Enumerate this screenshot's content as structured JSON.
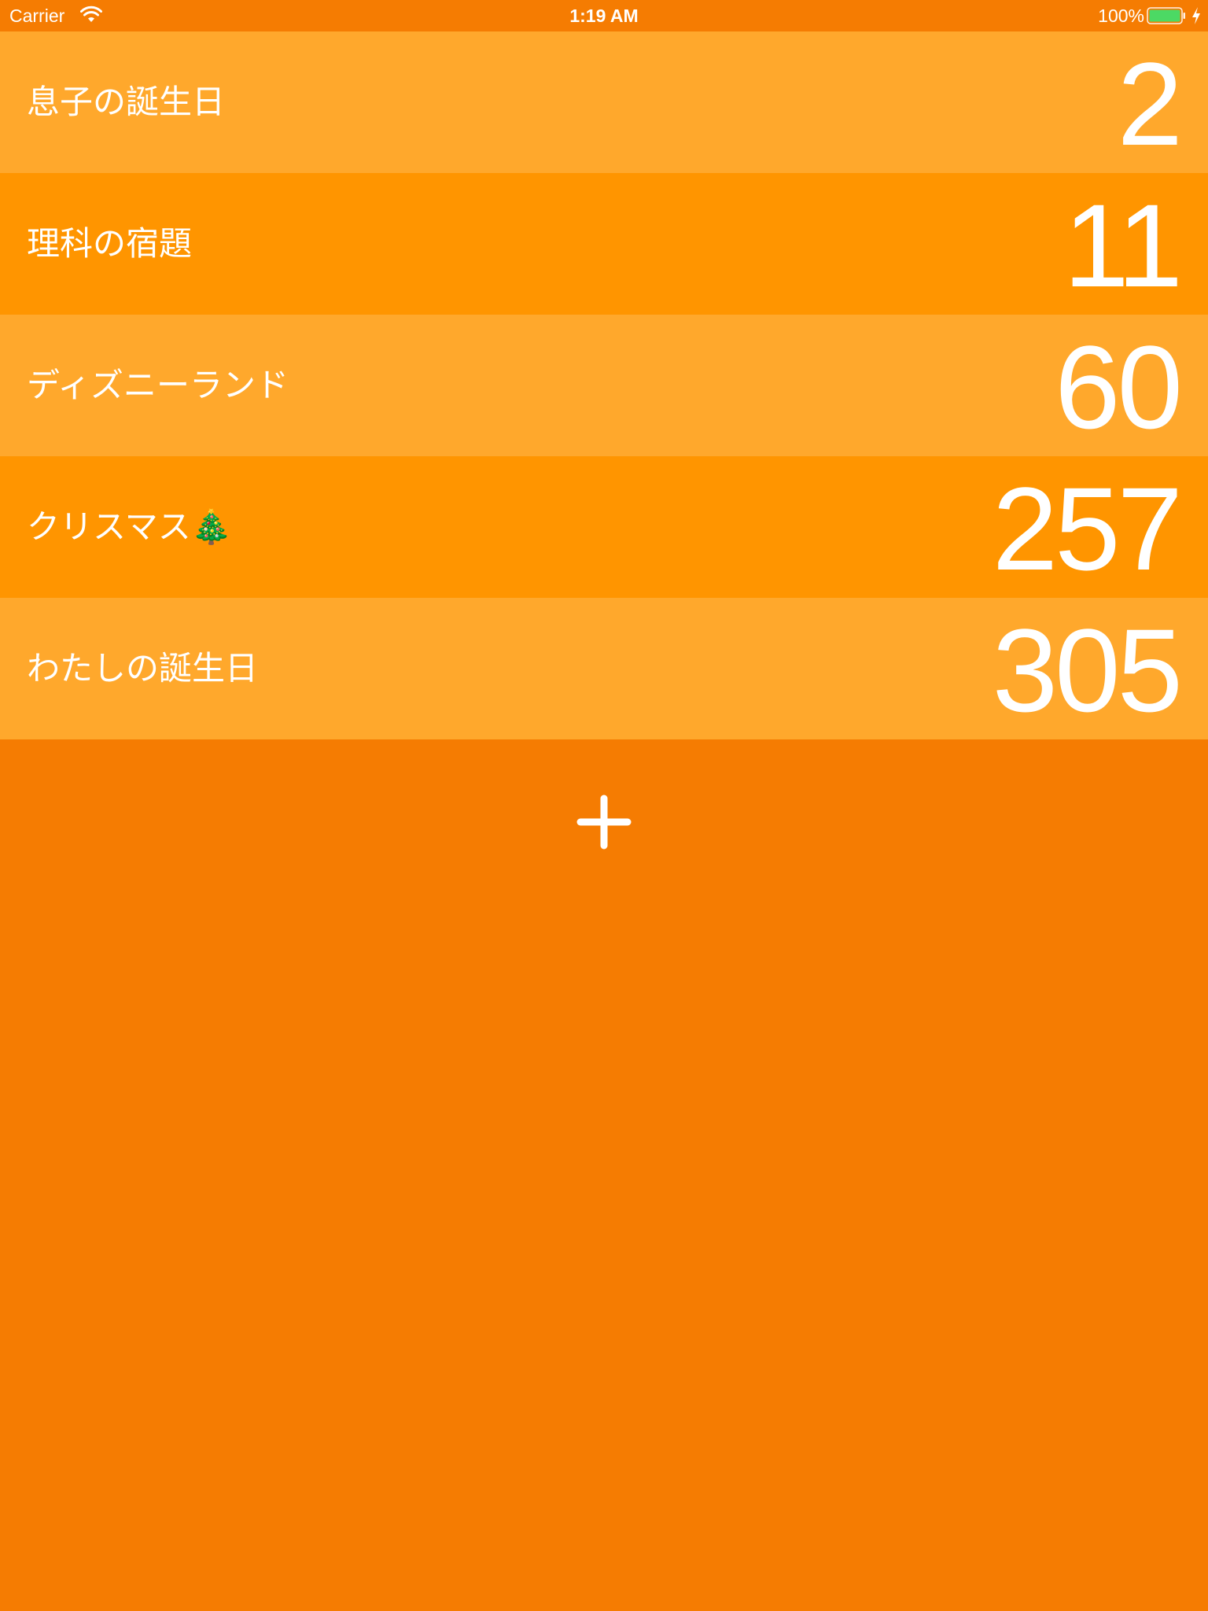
{
  "status_bar": {
    "carrier": "Carrier",
    "time": "1:19 AM",
    "battery_percent": "100%",
    "icons": [
      "wifi-icon",
      "battery-icon",
      "charging-icon"
    ],
    "battery_color": "#4CD964"
  },
  "colors": {
    "background": "#F57C02",
    "row_light": "#FFA82C",
    "row_dark": "#FF9500",
    "text": "#FFFFFF"
  },
  "events": [
    {
      "title": "息子の誕生日",
      "count": "2"
    },
    {
      "title": "理科の宿題",
      "count": "11"
    },
    {
      "title": "ディズニーランド",
      "count": "60"
    },
    {
      "title": "クリスマス🎄",
      "count": "257"
    },
    {
      "title": "わたしの誕生日",
      "count": "305"
    }
  ],
  "add_button": {
    "icon": "plus-icon"
  }
}
